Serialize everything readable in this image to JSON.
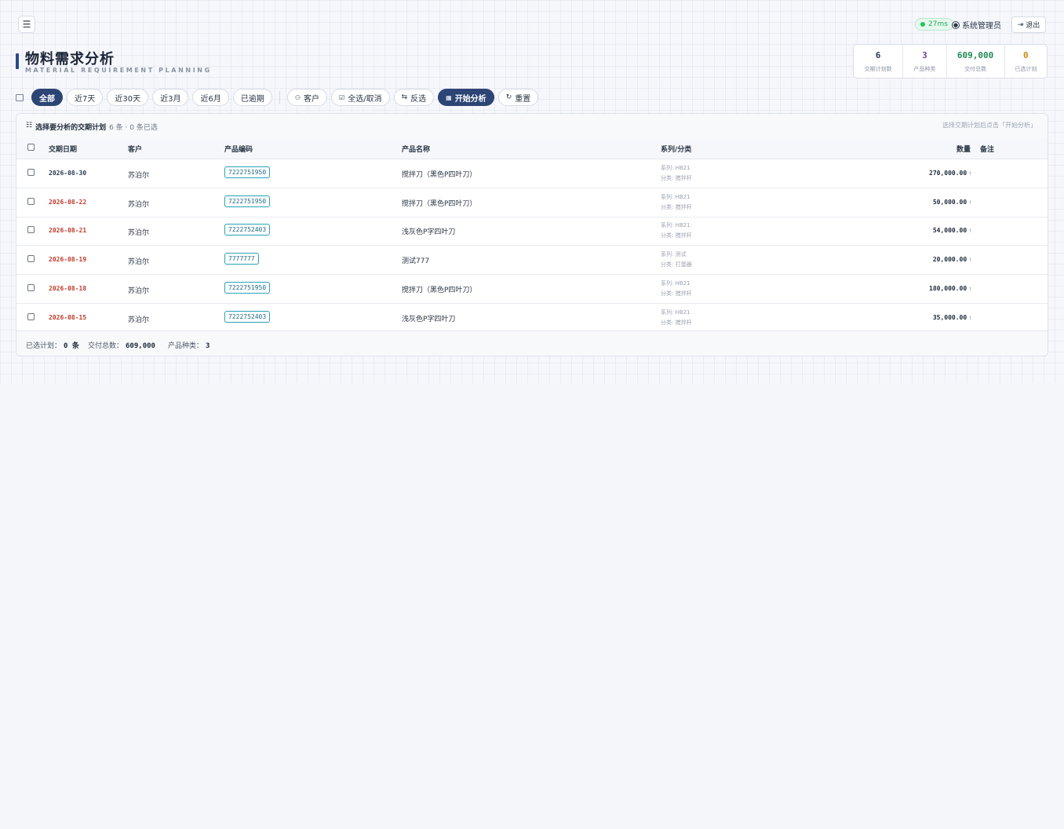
{
  "header": {
    "latency": "27ms",
    "user": "系统管理员",
    "logout": "退出",
    "title": "物料需求分析",
    "subtitle": "MATERIAL REQUIREMENT PLANNING"
  },
  "stats": [
    {
      "value": "6",
      "label": "交期计划数",
      "color": "#2b3a55"
    },
    {
      "value": "3",
      "label": "产品种类",
      "color": "#6b3fa0"
    },
    {
      "value": "609,000",
      "label": "交付总数",
      "color": "#1f8a55"
    },
    {
      "value": "0",
      "label": "已选计划",
      "color": "#c98a12"
    }
  ],
  "toolbar": {
    "ranges": [
      "全部",
      "近7天",
      "近30天",
      "近3月",
      "近6月",
      "已逾期"
    ],
    "active_range": "全部",
    "customer": "客户",
    "select_all": "全选/取消",
    "invert": "反选",
    "analyze": "开始分析",
    "reset": "重置"
  },
  "panel": {
    "title": "选择要分析的交期计划",
    "count": "6 条 · 0 条已选",
    "hint": "选择交期计划后点击「开始分析」"
  },
  "columns": [
    "交期日期",
    "客户",
    "产品编码",
    "产品名称",
    "系列/分类",
    "数量",
    "备注"
  ],
  "rows": [
    {
      "date": "2026-08-30",
      "date_color": "#2b3a55",
      "customer": "苏泊尔",
      "code": "7222751950",
      "name": "搅拌刀（黑色P四叶刀）",
      "series": "系列: HB21",
      "category": "分类: 搅拌杆",
      "qty": "270,000.00"
    },
    {
      "date": "2026-08-22",
      "date_color": "#c0392b",
      "customer": "苏泊尔",
      "code": "7222751950",
      "name": "搅拌刀（黑色P四叶刀）",
      "series": "系列: HB21",
      "category": "分类: 搅拌杆",
      "qty": "50,000.00"
    },
    {
      "date": "2026-08-21",
      "date_color": "#c0392b",
      "customer": "苏泊尔",
      "code": "7222752403",
      "name": "浅灰色P字四叶刀",
      "series": "系列: HB21",
      "category": "分类: 搅拌杆",
      "qty": "54,000.00"
    },
    {
      "date": "2026-08-19",
      "date_color": "#c0392b",
      "customer": "苏泊尔",
      "code": "7777777",
      "name": "测试777",
      "series": "系列: 测试",
      "category": "分类: 打蛋器",
      "qty": "20,000.00"
    },
    {
      "date": "2026-08-18",
      "date_color": "#c0392b",
      "customer": "苏泊尔",
      "code": "7222751950",
      "name": "搅拌刀（黑色P四叶刀）",
      "series": "系列: HB21",
      "category": "分类: 搅拌杆",
      "qty": "180,000.00"
    },
    {
      "date": "2026-08-15",
      "date_color": "#c0392b",
      "customer": "苏泊尔",
      "code": "7222752403",
      "name": "浅灰色P字四叶刀",
      "series": "系列: HB21",
      "category": "分类: 搅拌杆",
      "qty": "35,000.00"
    }
  ],
  "footer": {
    "selected_label": "已选计划：",
    "selected_value": "0 条",
    "total_label": "交付总数：",
    "total_value": "609,000",
    "kinds_label": "产品种类：",
    "kinds_value": "3"
  }
}
